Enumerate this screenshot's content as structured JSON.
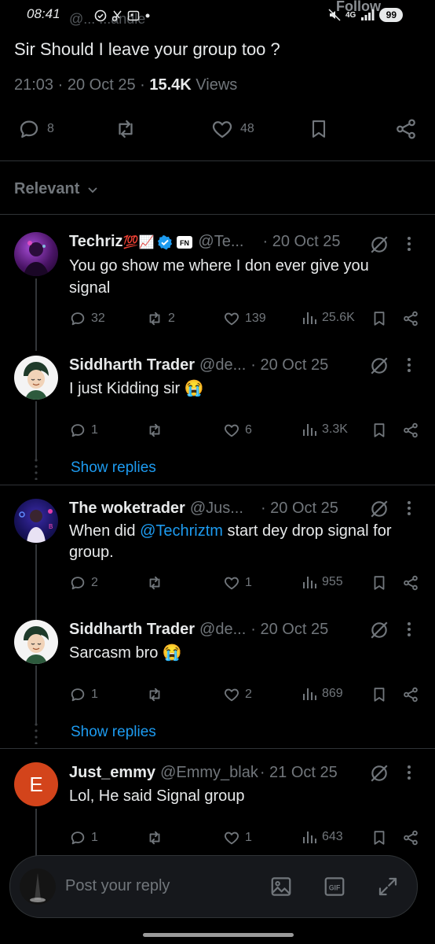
{
  "status_bar": {
    "time": "08:41",
    "handle_behind": "@... ...andle",
    "follow_behind": "Follow",
    "network": "4G",
    "battery": "99"
  },
  "main_tweet": {
    "text": "Sir Should I leave your group too ?",
    "time": "21:03",
    "date": "20 Oct 25",
    "views_count": "15.4K",
    "views_label": "Views",
    "replies": "8",
    "likes": "48"
  },
  "sort": {
    "label": "Relevant"
  },
  "replies": [
    {
      "name": "Techriz",
      "name_emoji": "💯📈",
      "handle": "@Te...",
      "date": "· 20 Oct 25",
      "text": "You go show me where I don ever give you signal",
      "replies": "32",
      "reposts": "2",
      "likes": "139",
      "views": "25.6K"
    },
    {
      "name": "Siddharth Trader",
      "handle": "@de...",
      "date": "· 20 Oct 25",
      "text": "I just Kidding sir 😭",
      "replies": "1",
      "reposts": "",
      "likes": "6",
      "views": "3.3K",
      "show_replies": "Show replies"
    },
    {
      "name": "The woketrader",
      "handle": "@Jus...",
      "date": "· 20 Oct 25",
      "text_before": "When did ",
      "mention": "@Techriztm",
      "text_after": " start dey drop signal for group.",
      "replies": "2",
      "reposts": "",
      "likes": "1",
      "views": "955"
    },
    {
      "name": "Siddharth Trader",
      "handle": "@de...",
      "date": "· 20 Oct 25",
      "text": "Sarcasm bro 😭",
      "replies": "1",
      "reposts": "",
      "likes": "2",
      "views": "869",
      "show_replies": "Show replies"
    },
    {
      "name": "Just_emmy",
      "handle": "@Emmy_blak",
      "date": "· 21 Oct 25",
      "avatar_letter": "E",
      "text": "Lol, He said Signal group",
      "replies": "1",
      "reposts": "",
      "likes": "1",
      "views": "643"
    }
  ],
  "composer": {
    "placeholder": "Post your reply"
  },
  "colors": {
    "background": "#000000",
    "text": "#e7e9ea",
    "muted": "#71767b",
    "accent": "#1d9bf0",
    "verified": "#1d9bf0",
    "avatar_e": "#d3441b"
  },
  "icons": [
    "reply-icon",
    "repost-icon",
    "like-icon",
    "bookmark-icon",
    "share-icon",
    "views-icon",
    "grok-icon",
    "more-icon",
    "image-icon",
    "gif-icon",
    "expand-icon",
    "chevron-down-icon",
    "verified-badge-icon"
  ]
}
